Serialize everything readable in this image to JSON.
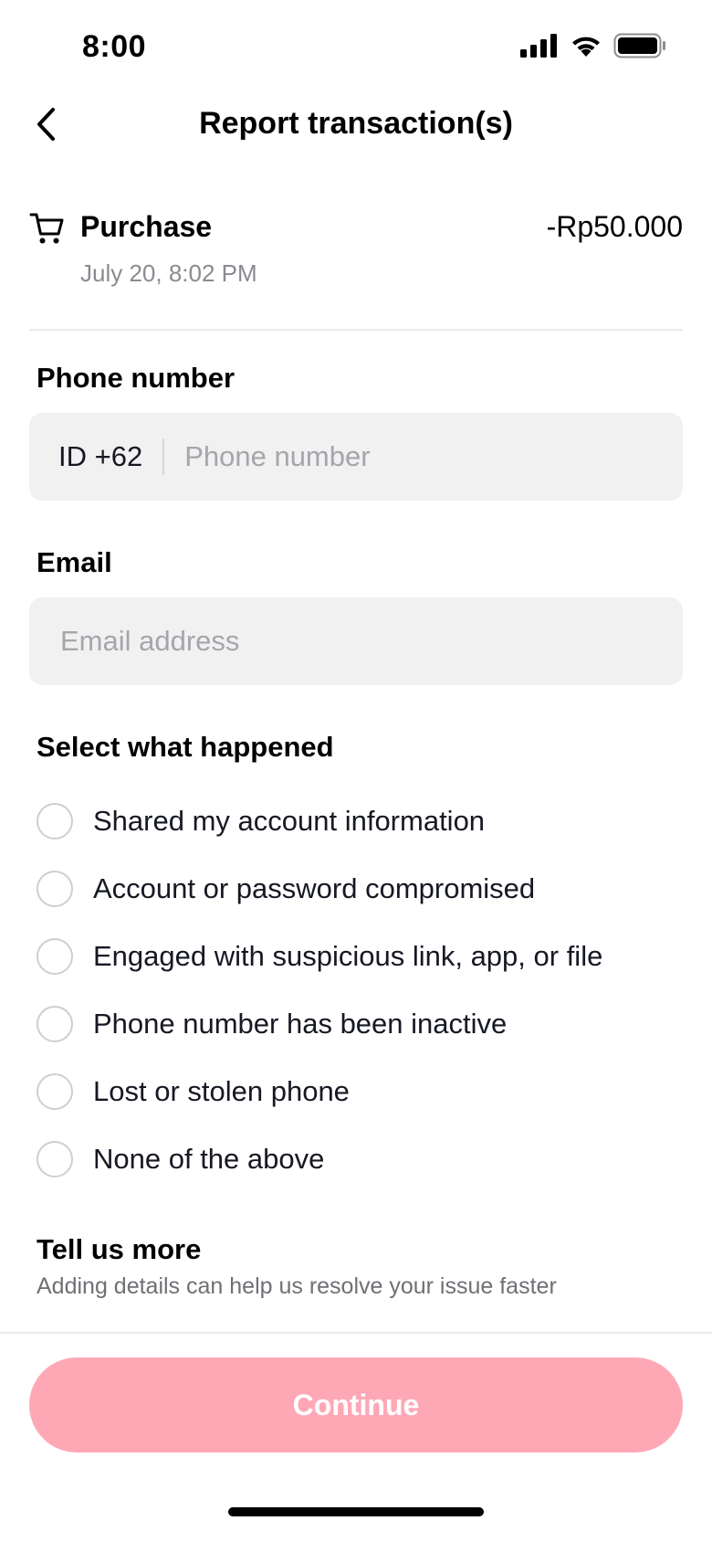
{
  "status_bar": {
    "time": "8:00",
    "icons": [
      "signal-icon",
      "wifi-icon",
      "battery-icon"
    ]
  },
  "nav": {
    "title": "Report transaction(s)",
    "back_icon": "chevron-left-icon"
  },
  "transaction": {
    "icon": "cart-icon",
    "type": "Purchase",
    "date": "July 20, 8:02 PM",
    "amount": "-Rp50.000"
  },
  "phone": {
    "label": "Phone number",
    "country_code": "ID +62",
    "placeholder": "Phone number",
    "value": ""
  },
  "email": {
    "label": "Email",
    "placeholder": "Email address",
    "value": ""
  },
  "what_happened": {
    "label": "Select what happened",
    "options": [
      {
        "label": "Shared my account information",
        "selected": false
      },
      {
        "label": "Account or password compromised",
        "selected": false
      },
      {
        "label": "Engaged with suspicious link, app, or file",
        "selected": false
      },
      {
        "label": "Phone number has been inactive",
        "selected": false
      },
      {
        "label": "Lost or stolen phone",
        "selected": false
      },
      {
        "label": "None of the above",
        "selected": false
      }
    ]
  },
  "tell_more": {
    "title": "Tell us more",
    "subtitle": "Adding details can help us resolve your issue faster"
  },
  "footer": {
    "continue_label": "Continue",
    "continue_color": "#fea8b6"
  }
}
